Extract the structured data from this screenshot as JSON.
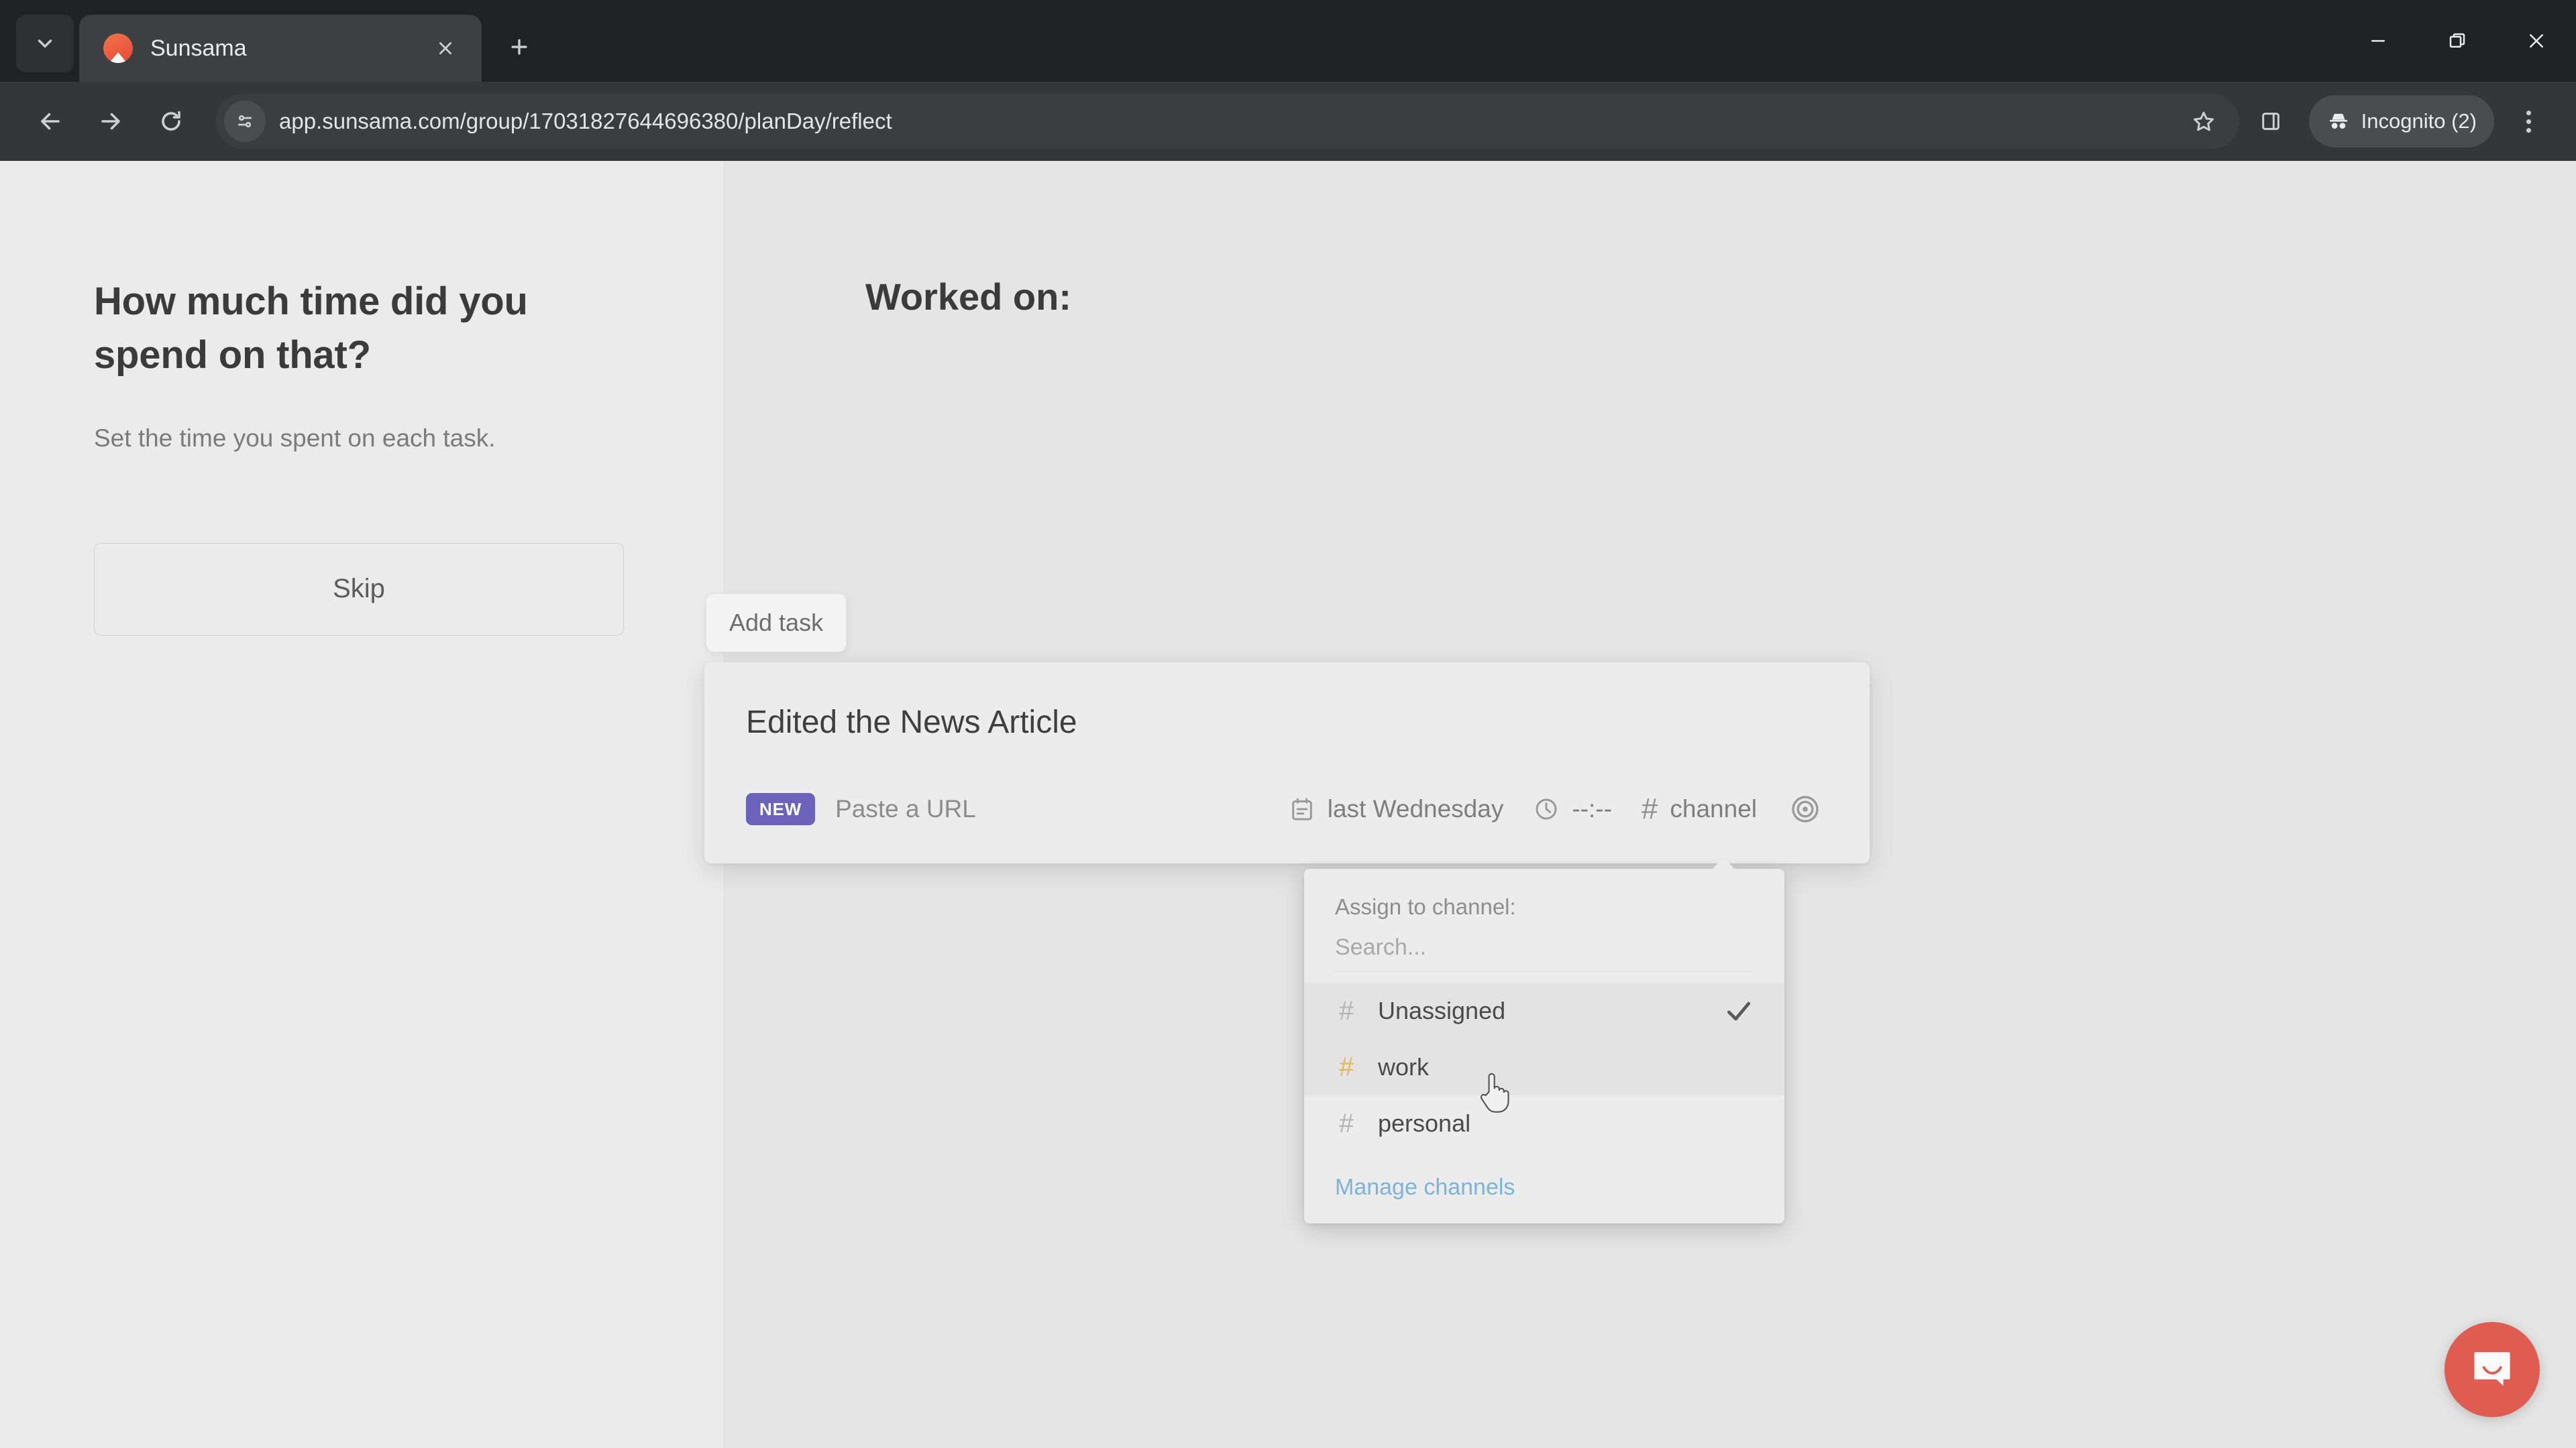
{
  "browser": {
    "tab": {
      "title": "Sunsama",
      "favicon_name": "sunsama-favicon"
    },
    "url": "app.sunsama.com/group/17031827644696380/planDay/reflect",
    "profile_label": "Incognito (2)",
    "icons": {
      "tab_search": "chevron-down-icon",
      "tab_close": "close-icon",
      "new_tab": "plus-icon",
      "back": "back-arrow-icon",
      "forward": "forward-arrow-icon",
      "reload": "reload-icon",
      "site_info": "site-settings-icon",
      "bookmark": "star-icon",
      "side_panel": "side-panel-icon",
      "incognito": "incognito-icon",
      "menu": "three-dots-menu-icon",
      "minimize": "minimize-icon",
      "maximize": "restore-window-icon",
      "close_window": "close-window-icon"
    }
  },
  "left_panel": {
    "title": "How much time did you spend on that?",
    "subtitle": "Set the time you spent on each task.",
    "skip_label": "Skip"
  },
  "right_panel": {
    "title": "Worked on:",
    "add_task_row_label": "Add task",
    "add_task_float_label": "Add task"
  },
  "task_card": {
    "title": "Edited the News Article",
    "badge": "NEW",
    "paste_url_label": "Paste a URL",
    "date_label": "last Wednesday",
    "time_label": "--:--",
    "channel_label": "channel",
    "channel_hash": "#",
    "icons": {
      "calendar": "calendar-icon",
      "clock": "clock-icon",
      "hash": "hash-icon",
      "focus": "target-focus-icon"
    }
  },
  "channel_dropdown": {
    "heading": "Assign to channel:",
    "search_placeholder": "Search...",
    "search_value": "",
    "items": [
      {
        "label": "Unassigned",
        "hash": "#",
        "hash_color": "#b5b5b5",
        "selected": true,
        "hovered": false
      },
      {
        "label": "work",
        "hash": "#",
        "hash_color": "#e8b55c",
        "selected": false,
        "hovered": true
      },
      {
        "label": "personal",
        "hash": "#",
        "hash_color": "#b5b5b5",
        "selected": false,
        "hovered": false
      }
    ],
    "footer_link": "Manage channels"
  },
  "messenger": {
    "name": "intercom-messenger",
    "color": "#df5c51"
  },
  "colors": {
    "accent_purple": "#6b63bb",
    "link_blue": "#7db3d8",
    "channel_work": "#e8b55c",
    "page_bg": "#e9e9e9"
  }
}
